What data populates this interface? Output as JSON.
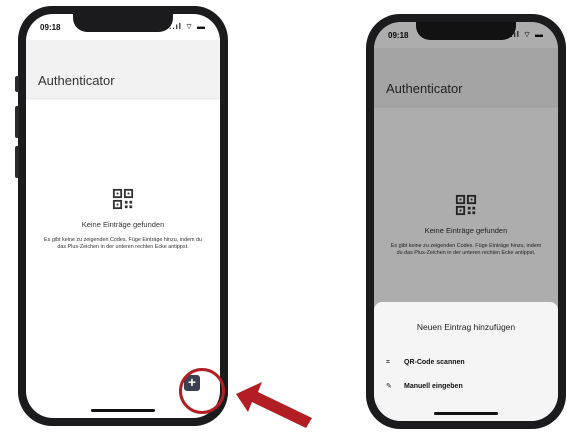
{
  "status_bar": {
    "time": "09:18",
    "icons": "..ıl ⌔ ▬"
  },
  "app": {
    "title": "Authenticator"
  },
  "empty_state": {
    "icon": "qr-code-icon",
    "title": "Keine Einträge gefunden",
    "description": "Es gibt keine zu zeigenden Codes. Füge Einträge hinzu, indem du das Plus-Zeichen in der unteren rechten Ecke antippst."
  },
  "fab": {
    "label": "+",
    "icon": "plus-icon"
  },
  "sheet": {
    "title": "Neuen Eintrag hinzufügen",
    "items": [
      {
        "label": "QR-Code scannen",
        "icon": "qr-scan-icon"
      },
      {
        "label": "Manuell eingeben",
        "icon": "pencil-icon"
      }
    ]
  },
  "colors": {
    "highlight": "#b21e24",
    "fab": "#3b4150",
    "appbar": "#f2f2f2"
  }
}
